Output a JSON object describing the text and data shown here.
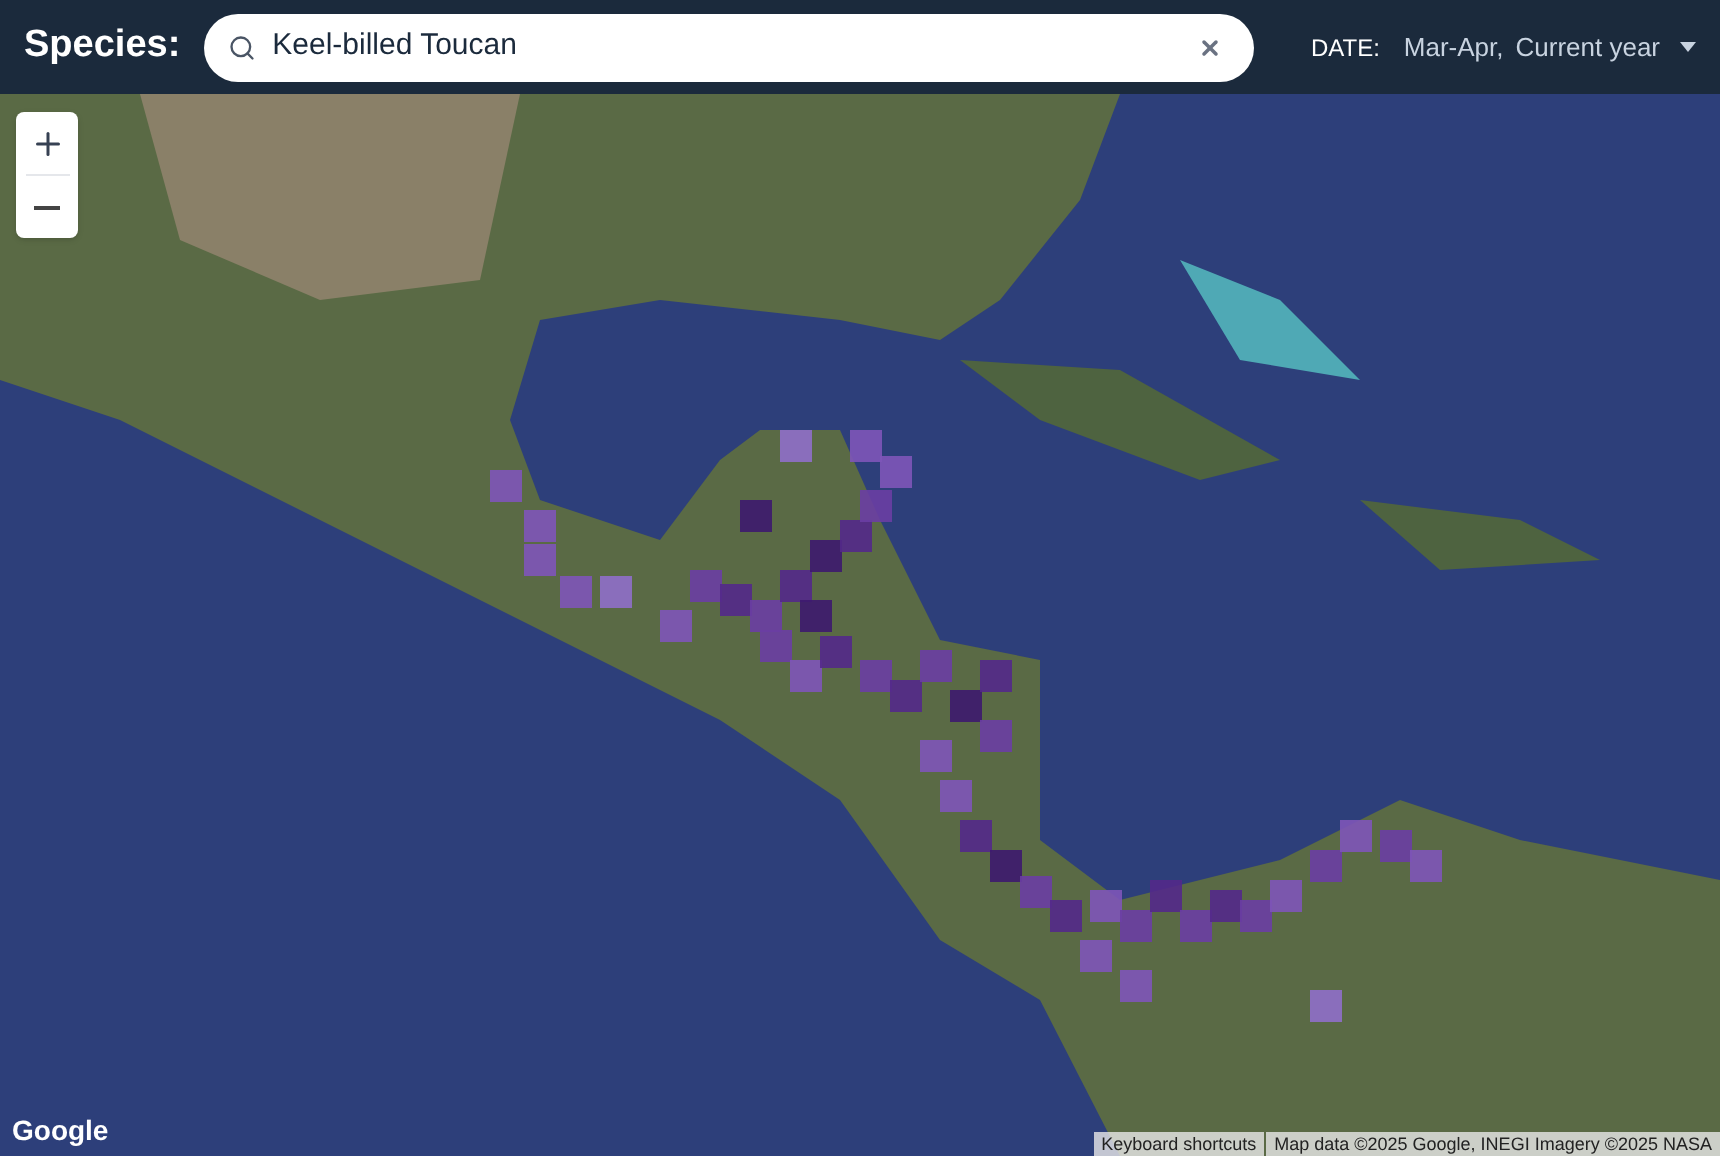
{
  "header": {
    "label": "Species:",
    "search": {
      "value": "Keel-billed Toucan"
    },
    "date": {
      "label": "DATE:",
      "range": "Mar-Apr,",
      "year": "Current year"
    }
  },
  "map": {
    "logo": "Google",
    "attribution": [
      "Keyboard shortcuts",
      "Map data ©2025 Google, INEGI Imagery ©2025 NASA"
    ]
  }
}
